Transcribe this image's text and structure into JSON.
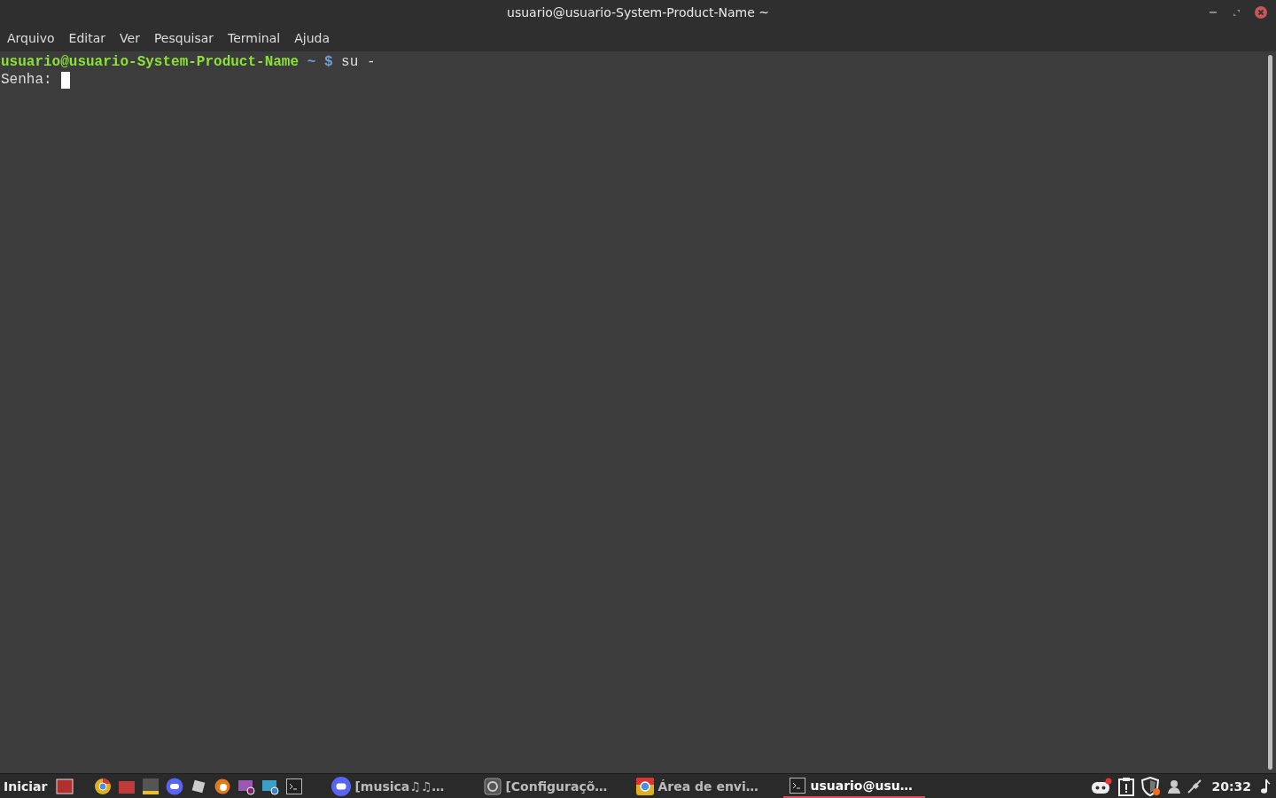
{
  "window": {
    "title": "usuario@usuario-System-Product-Name ~"
  },
  "menu": [
    "Arquivo",
    "Editar",
    "Ver",
    "Pesquisar",
    "Terminal",
    "Ajuda"
  ],
  "terminal": {
    "prompt_user": "usuario@usuario-System-Product-Name",
    "prompt_dir": "~",
    "prompt_sign": "$",
    "command": "su -",
    "output": "Senha:"
  },
  "taskbar": {
    "start": "Iniciar",
    "tasks": [
      {
        "kind": "chat",
        "label": "[musica♫♫…",
        "selected": false
      },
      {
        "kind": "settings",
        "label": "[Configuraçõ…",
        "selected": false
      },
      {
        "kind": "browser",
        "label": "Área de envi…",
        "selected": false
      },
      {
        "kind": "terminal",
        "label": "usuario@usu…",
        "selected": true
      }
    ],
    "clock": "20:32"
  }
}
